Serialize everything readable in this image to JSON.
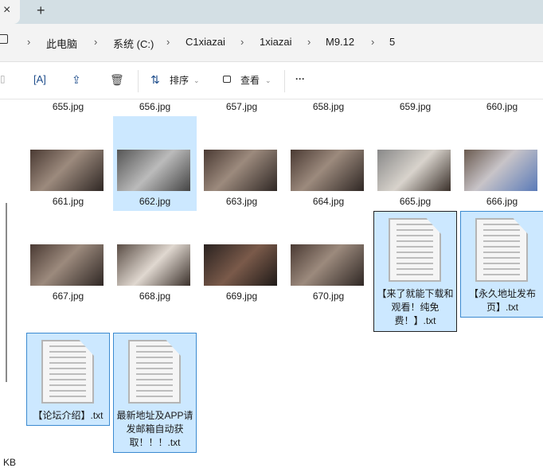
{
  "tabs": {
    "close": "×",
    "new": "+"
  },
  "breadcrumb": [
    "此电脑",
    "系统 (C:)",
    "C1xiazai",
    "1xiazai",
    "M9.12",
    "5"
  ],
  "toolbar": {
    "sort": "排序",
    "view": "查看",
    "more": "···"
  },
  "row1": [
    "655.jpg",
    "656.jpg",
    "657.jpg",
    "658.jpg",
    "659.jpg",
    "660.jpg"
  ],
  "row2": [
    "661.jpg",
    "662.jpg",
    "663.jpg",
    "664.jpg",
    "665.jpg",
    "666.jpg"
  ],
  "row3": [
    "667.jpg",
    "668.jpg",
    "669.jpg",
    "670.jpg"
  ],
  "txt": [
    "【来了就能下载和观看！纯免费！】.txt",
    "【永久地址发布页】.txt",
    "【论坛介绍】.txt",
    "最新地址及APP请发邮箱自动获取！！！.txt"
  ],
  "status": "KB"
}
